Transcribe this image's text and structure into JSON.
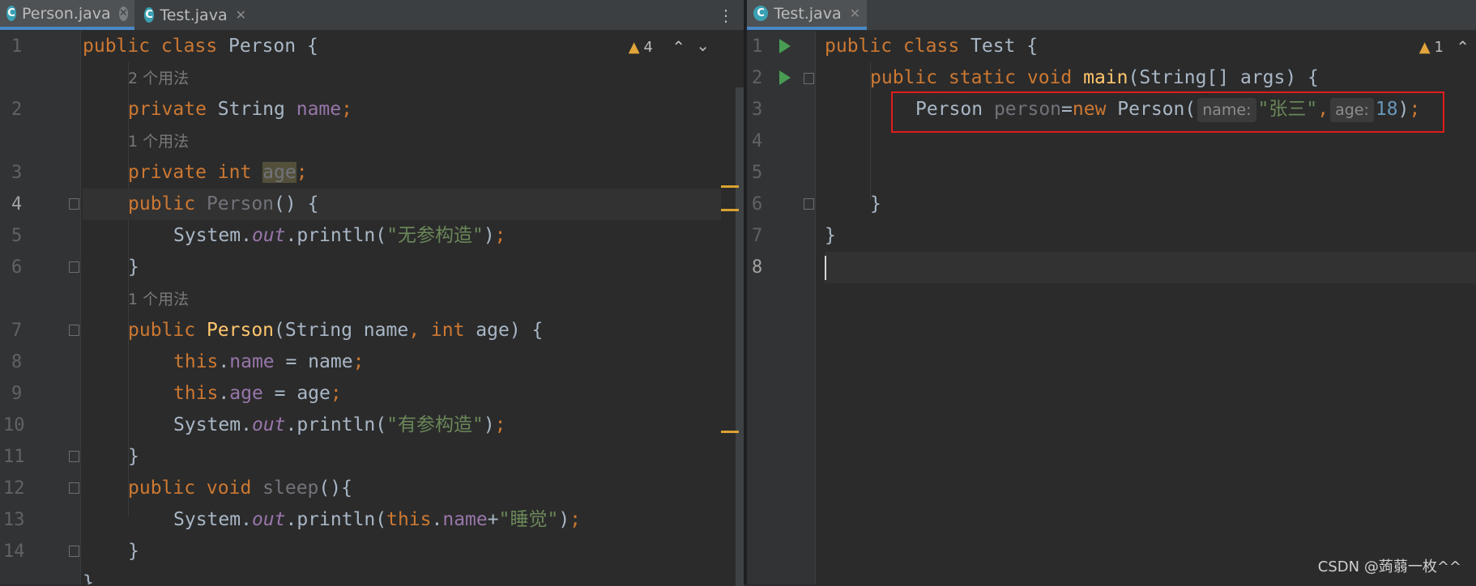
{
  "left": {
    "tabs": [
      {
        "label": "Person.java",
        "icon": "java-class-icon",
        "active": true
      },
      {
        "label": "Test.java",
        "icon": "java-class-icon",
        "active": false
      }
    ],
    "warnings": "4",
    "line_numbers": [
      "1",
      "2",
      "3",
      "4",
      "5",
      "6",
      "7",
      "8",
      "9",
      "10",
      "11",
      "12",
      "13",
      "14"
    ],
    "usage_hints": [
      "2 个用法",
      "1 个用法",
      "1 个用法"
    ],
    "code": {
      "l1": {
        "kw": "public class ",
        "name": "Person",
        "rest": " {"
      },
      "l2": {
        "kw": "private ",
        "type": "String ",
        "field": "name",
        "semi": ";"
      },
      "l3": {
        "kw": "private int ",
        "field": "age",
        "semi": ";"
      },
      "l4": {
        "kw": "public ",
        "name": "Person",
        "rest": "() {"
      },
      "l5": {
        "pre": "System.",
        "out": "out",
        "mid": ".println(",
        "str": "\"无参构造\"",
        "end": ")",
        "semi": ";"
      },
      "l6": {
        "text": "}"
      },
      "l7": {
        "kw": "public ",
        "name": "Person",
        "open": "(String name",
        "comma": ", ",
        "kw2": "int ",
        "rest": "age) {"
      },
      "l8": {
        "kw": "this",
        "dot": ".",
        "field": "name",
        "rest": " = name",
        "semi": ";"
      },
      "l9": {
        "kw": "this",
        "dot": ".",
        "field": "age",
        "rest": " = age",
        "semi": ";"
      },
      "l10": {
        "pre": "System.",
        "out": "out",
        "mid": ".println(",
        "str": "\"有参构造\"",
        "end": ")",
        "semi": ";"
      },
      "l11": {
        "text": "}"
      },
      "l12": {
        "kw": "public void ",
        "name": "sleep",
        "rest": "(){"
      },
      "l13": {
        "pre": "System.",
        "out": "out",
        "mid": ".println(",
        "kw": "this",
        "dot": ".",
        "field": "name",
        "plus": "+",
        "str": "\"睡觉\"",
        "end": ")",
        "semi": ";"
      },
      "l14": {
        "text": "}"
      },
      "l15": {
        "text": "}"
      }
    }
  },
  "right": {
    "tab": {
      "label": "Test.java",
      "icon": "java-class-icon",
      "active": true
    },
    "warnings": "1",
    "line_numbers": [
      "1",
      "2",
      "3",
      "4",
      "5",
      "6",
      "7",
      "8"
    ],
    "code": {
      "l1": {
        "kw": "public class ",
        "name": "Test",
        "rest": " {"
      },
      "l2": {
        "kw": "public static void ",
        "name": "main",
        "rest": "(String[] args) {"
      },
      "l3": {
        "type": "Person ",
        "var": "person",
        "eq": "=",
        "kw": "new ",
        "cls": "Person(",
        "hint1": "name:",
        "str": "\"张三\"",
        "comma": ",",
        "hint2": "age:",
        "num": "18",
        "end": ")",
        "semi": ";"
      },
      "l6": {
        "text": "}"
      },
      "l7": {
        "text": "}"
      }
    }
  },
  "watermark": "CSDN @蒟蒻一枚^^",
  "colors": {
    "keyword": "#cc7832",
    "function": "#ffc66d",
    "field": "#9876aa",
    "string": "#6a8759",
    "number": "#6897bb",
    "highlight_border": "#e01c1c"
  }
}
